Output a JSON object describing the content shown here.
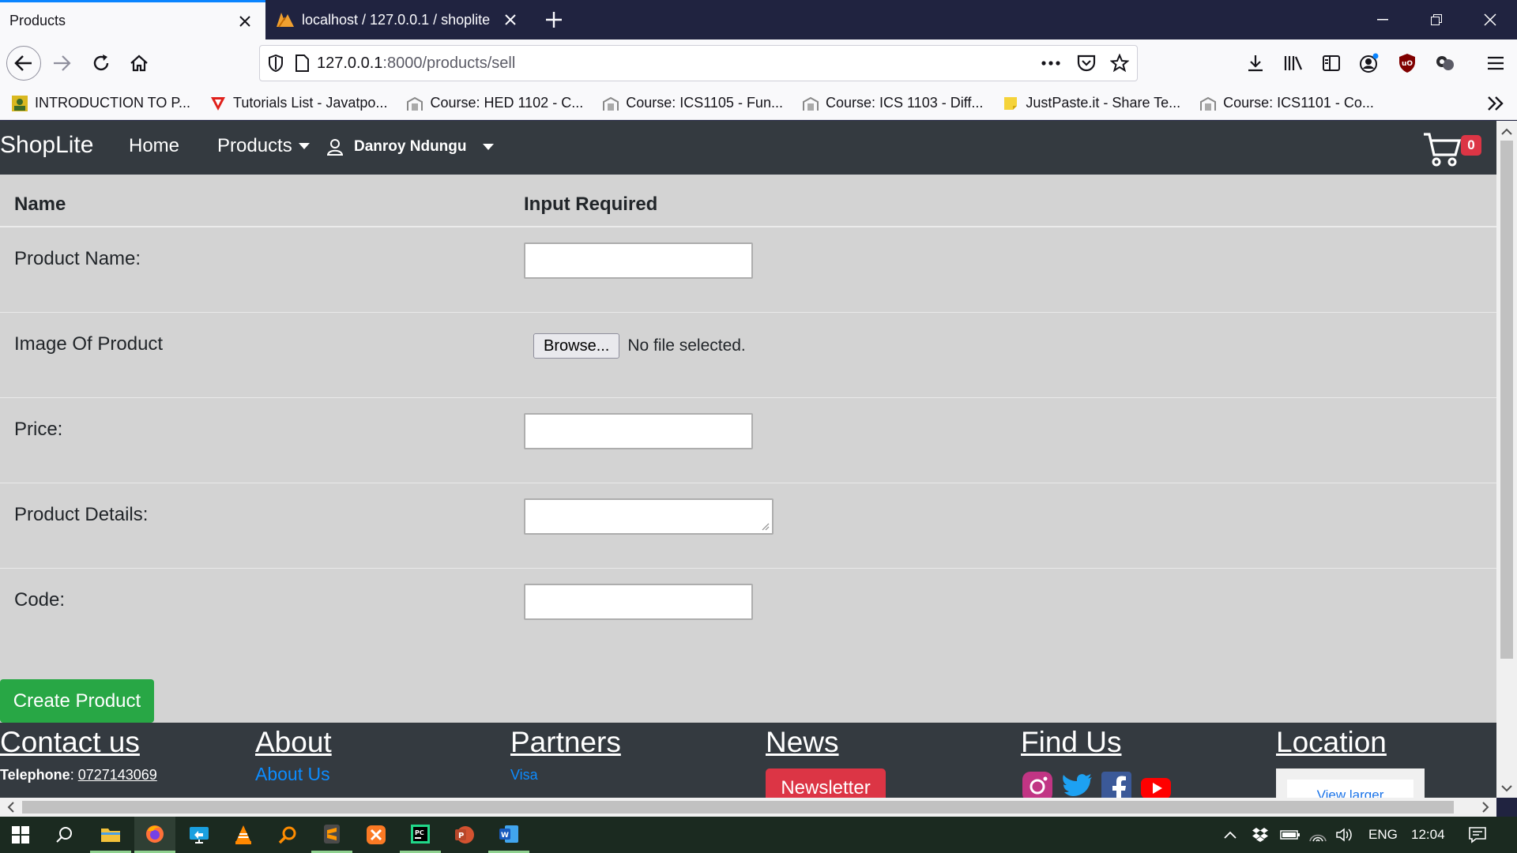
{
  "browser": {
    "tabs": [
      {
        "title": "Products",
        "active": true
      },
      {
        "title": "localhost / 127.0.0.1 / shoplite",
        "active": false
      }
    ],
    "url": {
      "host": "127.0.0.1",
      "path": ":8000/products/sell"
    },
    "bookmarks": [
      {
        "label": "INTRODUCTION TO P...",
        "icon": "image-icon"
      },
      {
        "label": "Tutorials List - Javatpo...",
        "icon": "javatpoint-icon"
      },
      {
        "label": "Course: HED 1102 - C...",
        "icon": "moodle-icon"
      },
      {
        "label": "Course: ICS1105 - Fun...",
        "icon": "moodle-icon"
      },
      {
        "label": "Course: ICS 1103 - Diff...",
        "icon": "moodle-icon"
      },
      {
        "label": "JustPaste.it - Share Te...",
        "icon": "note-icon"
      },
      {
        "label": "Course: ICS1101 - Co...",
        "icon": "moodle-icon"
      }
    ]
  },
  "site": {
    "brand": "ShopLite",
    "nav": {
      "home": "Home",
      "products": "Products",
      "user": "Danroy Ndungu"
    },
    "cart_count": "0"
  },
  "form": {
    "headers": {
      "name": "Name",
      "input": "Input Required"
    },
    "rows": [
      {
        "label": "Product Name:",
        "type": "text",
        "value": ""
      },
      {
        "label": "Image Of Product",
        "type": "file",
        "button": "Browse...",
        "status": "No file selected."
      },
      {
        "label": "Price:",
        "type": "text",
        "value": ""
      },
      {
        "label": "Product Details:",
        "type": "textarea",
        "value": ""
      },
      {
        "label": "Code:",
        "type": "text",
        "value": ""
      }
    ],
    "submit": "Create Product"
  },
  "footer": {
    "contact": {
      "heading": "Contact us",
      "tel_label": "Telephone",
      "tel_value": "0727143069"
    },
    "about": {
      "heading": "About",
      "link": "About Us"
    },
    "partners": {
      "heading": "Partners",
      "link": "Visa"
    },
    "news": {
      "heading": "News",
      "button": "Newsletter"
    },
    "find": {
      "heading": "Find Us",
      "icons": [
        "instagram-icon",
        "twitter-icon",
        "facebook-icon",
        "youtube-icon"
      ]
    },
    "location": {
      "heading": "Location",
      "map_link": "View larger"
    }
  },
  "taskbar": {
    "language": "ENG",
    "time": "12:04",
    "apps": [
      "file-explorer-icon",
      "firefox-icon",
      "remote-desktop-icon",
      "vlc-icon",
      "search-app-icon",
      "sublime-text-icon",
      "xampp-icon",
      "pycharm-icon",
      "powerpoint-icon",
      "word-icon"
    ]
  },
  "colors": {
    "accent": "#0a84ff",
    "navbar": "#343a40",
    "success": "#28a745",
    "danger": "#dc3545",
    "page_bg": "#d3d3d3"
  }
}
